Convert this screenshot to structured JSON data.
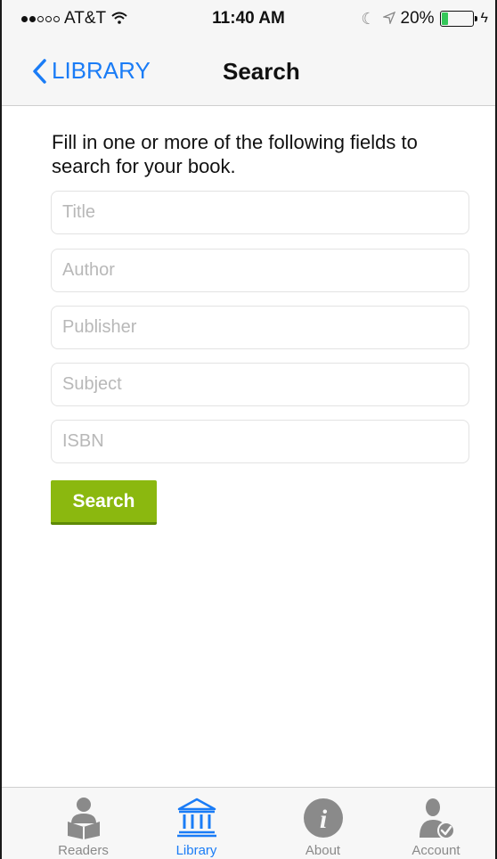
{
  "status_bar": {
    "carrier": "AT&T",
    "time": "11:40 AM",
    "battery": "20%",
    "battery_level": 0.2
  },
  "nav": {
    "back_label": "LIBRARY",
    "title": "Search"
  },
  "instructions": "Fill in one or more of the following fields to search for your book.",
  "fields": {
    "title": {
      "placeholder": "Title",
      "value": ""
    },
    "author": {
      "placeholder": "Author",
      "value": ""
    },
    "publisher": {
      "placeholder": "Publisher",
      "value": ""
    },
    "subject": {
      "placeholder": "Subject",
      "value": ""
    },
    "isbn": {
      "placeholder": "ISBN",
      "value": ""
    }
  },
  "search_button": "Search",
  "tabs": [
    {
      "label": "Readers",
      "icon": "readers-icon",
      "active": false
    },
    {
      "label": "Library",
      "icon": "library-icon",
      "active": true
    },
    {
      "label": "About",
      "icon": "info-icon",
      "active": false
    },
    {
      "label": "Account",
      "icon": "account-icon",
      "active": false
    }
  ],
  "colors": {
    "accent": "#1a7cf6",
    "button": "#8bb80f",
    "tab_inactive": "#8a8a8a"
  }
}
